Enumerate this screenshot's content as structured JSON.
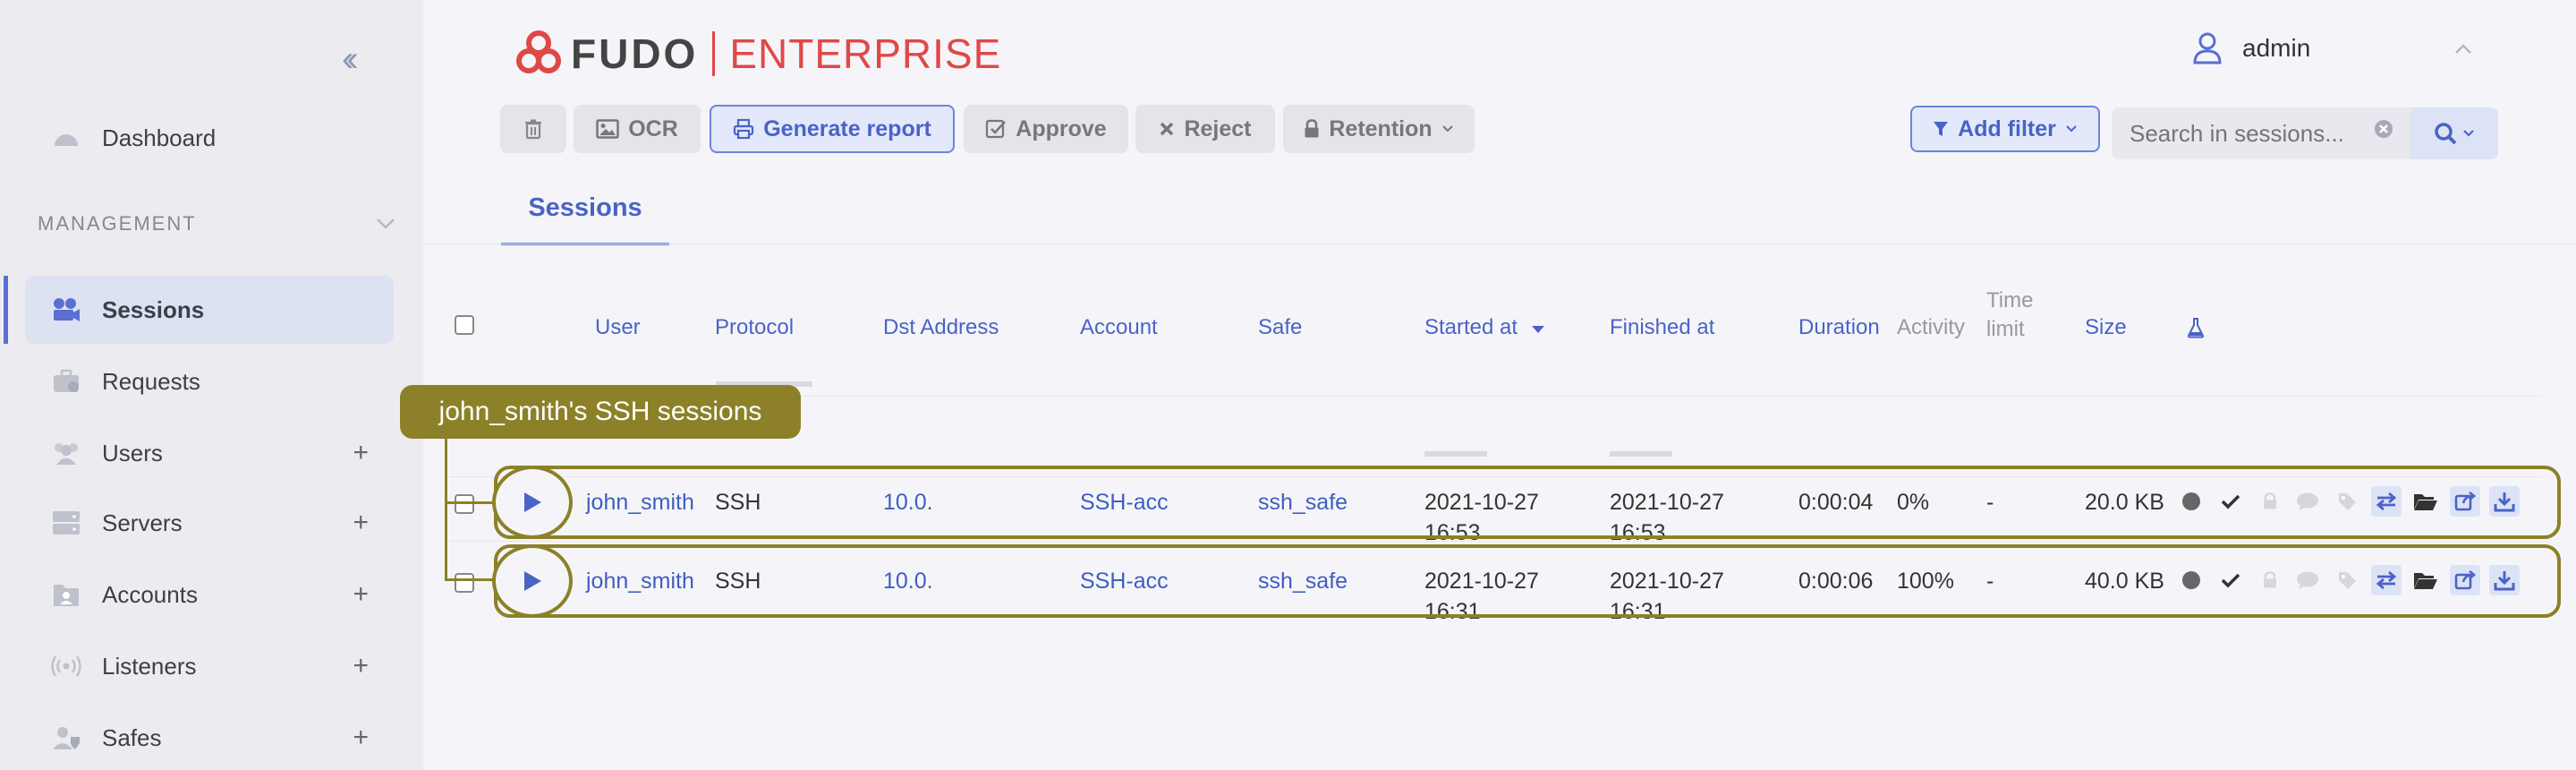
{
  "brand": {
    "logo_text": "FUDO",
    "product": "ENTERPRISE",
    "accent": "#e04848"
  },
  "user": {
    "name": "admin"
  },
  "sidebar": {
    "section": "MANAGEMENT",
    "items": [
      {
        "label": "Dashboard"
      },
      {
        "label": "Sessions"
      },
      {
        "label": "Requests"
      },
      {
        "label": "Users",
        "plus": "+"
      },
      {
        "label": "Servers",
        "plus": "+"
      },
      {
        "label": "Accounts",
        "plus": "+"
      },
      {
        "label": "Listeners",
        "plus": "+"
      },
      {
        "label": "Safes",
        "plus": "+"
      }
    ]
  },
  "toolbar": {
    "ocr": "OCR",
    "generate_report": "Generate report",
    "approve": "Approve",
    "reject": "Reject",
    "retention": "Retention",
    "add_filter": "Add filter"
  },
  "search": {
    "placeholder": "Search in sessions..."
  },
  "tabs": [
    {
      "label": "Sessions"
    }
  ],
  "table": {
    "headers": {
      "user": "User",
      "protocol": "Protocol",
      "dst_address": "Dst Address",
      "account": "Account",
      "safe": "Safe",
      "started_at": "Started at",
      "finished_at": "Finished at",
      "duration": "Duration",
      "activity": "Activity",
      "time_limit_1": "Time",
      "time_limit_2": "limit",
      "size": "Size"
    },
    "rows": [
      {
        "user": "john_smith",
        "protocol": "SSH",
        "dst": "10.0.",
        "account": "SSH-acc",
        "safe": "ssh_safe",
        "started_date": "2021-10-27",
        "started_time": "16:53",
        "finished_date": "2021-10-27",
        "finished_time": "16:53",
        "duration": "0:00:04",
        "activity": "0%",
        "time_limit": "-",
        "size": "20.0 KB"
      },
      {
        "user": "john_smith",
        "protocol": "SSH",
        "dst": "10.0.",
        "account": "SSH-acc",
        "safe": "ssh_safe",
        "started_date": "2021-10-27",
        "started_time": "16:31",
        "finished_date": "2021-10-27",
        "finished_time": "16:31",
        "duration": "0:00:06",
        "activity": "100%",
        "time_limit": "-",
        "size": "40.0 KB"
      }
    ]
  },
  "annotation": {
    "tooltip": "john_smith's SSH sessions",
    "color": "#8c8128"
  },
  "icons": {
    "collapse": "double-chevron-left-icon",
    "dashboard": "dashboard-icon",
    "sessions": "video-camera-icon",
    "requests": "briefcase-icon",
    "users": "users-icon",
    "servers": "server-icon",
    "accounts": "account-icon",
    "listeners": "broadcast-icon",
    "safes": "safe-icon",
    "delete": "trash-icon",
    "ocr": "image-icon",
    "report": "printer-icon",
    "approve": "check-square-icon",
    "reject": "x-icon",
    "retention": "lock-icon",
    "filter": "funnel-icon",
    "search": "magnifier-icon",
    "flask": "flask-icon"
  }
}
